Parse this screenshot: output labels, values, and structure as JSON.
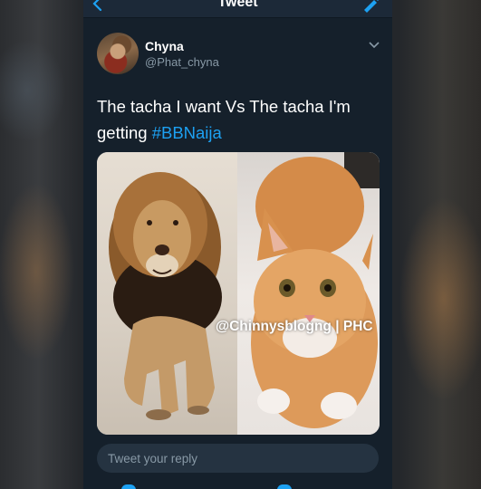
{
  "header": {
    "title": "Tweet"
  },
  "tweet": {
    "display_name": "Chyna",
    "handle": "@Phat_chyna",
    "text_main": "The tacha I want Vs The tacha I'm getting ",
    "hashtag": "#BBNaija"
  },
  "media": {
    "watermark": "@Chinnysblogng | PHC"
  },
  "reply": {
    "placeholder": "Tweet your reply"
  },
  "colors": {
    "background": "#15202b",
    "accent": "#1da1f2",
    "muted": "#8899a6"
  },
  "icons": [
    "back-arrow-icon",
    "compose-icon",
    "chevron-down-icon"
  ]
}
